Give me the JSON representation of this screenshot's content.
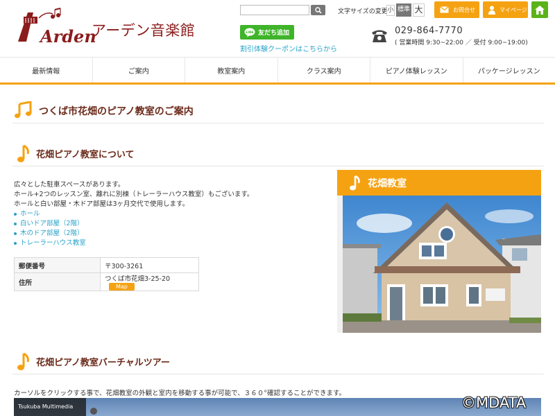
{
  "header": {
    "logo_text": "Arden",
    "site_title": "アーデン音楽館",
    "search_placeholder": "",
    "font_size_label": "文字サイズの変更",
    "font_sizes": [
      "小",
      "標準",
      "大"
    ],
    "contact_label": "お問合せ",
    "mypage_label": "マイページ",
    "line_label": "友だち追加",
    "coupon_link": "割引体験クーポンはこちらから",
    "phone_number": "029-864-7770",
    "hours": "( 営業時間 9:30~22:00 ／ 受付 9:00~19:00)"
  },
  "nav": {
    "items": [
      "最新情報",
      "ご案内",
      "教室案内",
      "クラス案内",
      "ピアノ体験レッスン",
      "パッケージレッスン"
    ]
  },
  "main": {
    "page_title": "つくば市花畑のピアノ教室のご案内",
    "section1_title": "花畑ピアノ教室について",
    "desc_lines": [
      "広々とした駐車スペースがあります。",
      "ホール+2つのレッスン室、離れに別棟（トレーラーハウス教室）もございます。",
      "ホールと白い部屋・木ドア部屋は3ヶ月交代で使用します。"
    ],
    "rooms": [
      "ホール",
      "白いドア部屋（2階）",
      "木のドア部屋（2階）",
      "トレーラーハウス教室"
    ],
    "table": {
      "postal_label": "郵便番号",
      "postal_value": "〒300-3261",
      "address_label": "住所",
      "address_value": "つくば市花畑3-25-20",
      "map_button": "Map"
    },
    "section2_title": "花畑ピアノ教室バーチャルツアー",
    "vt_text": "カーソルをクリックする事で、花畑教室の外観と室内を移動する事が可能で、３６０°確認することができます。",
    "vt_label": "Tsukuba Multimedia"
  },
  "sidebar": {
    "title": "花畑教室"
  },
  "watermark": "©MDATA",
  "colors": {
    "accent": "#f5a212",
    "title": "#6b2a1a",
    "link": "#27a3c9",
    "line_green": "#3fb42a",
    "home_green": "#5bb319"
  }
}
